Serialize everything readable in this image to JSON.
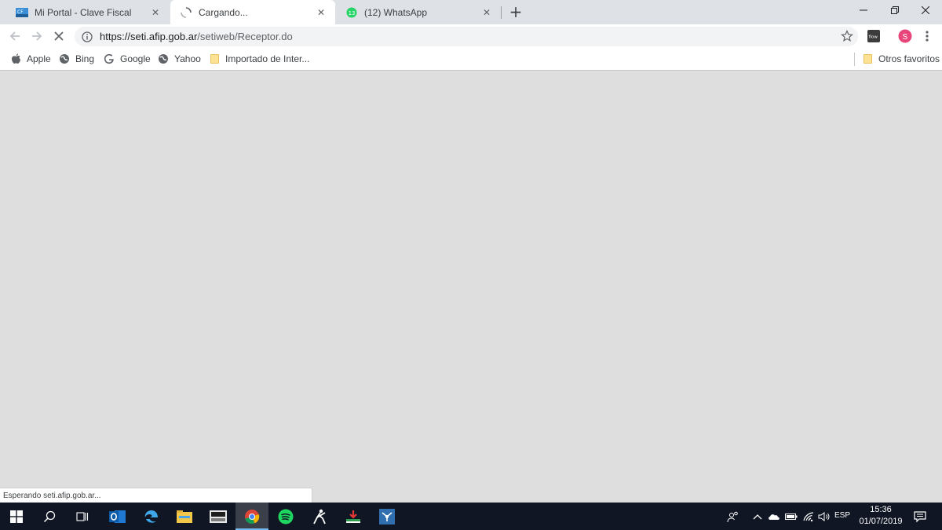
{
  "tabs": [
    {
      "title": "Mi Portal - Clave Fiscal",
      "icon": "afip-cf-icon",
      "active": false
    },
    {
      "title": "Cargando...",
      "icon": "loading-spinner-icon",
      "active": true
    },
    {
      "title": "(12) WhatsApp",
      "icon": "whatsapp-icon",
      "badge": "13",
      "active": false
    }
  ],
  "toolbar": {
    "url_host": "https://seti.afip.gob.ar",
    "url_path": "/setiweb/Receptor.do",
    "profile_initial": "S",
    "extension_label": "flow"
  },
  "bookmarks": [
    {
      "label": "Apple",
      "icon": "apple-icon"
    },
    {
      "label": "Bing",
      "icon": "globe-icon"
    },
    {
      "label": "Google",
      "icon": "google-icon"
    },
    {
      "label": "Yahoo",
      "icon": "globe-icon"
    },
    {
      "label": "Importado de Inter...",
      "icon": "folder-icon"
    }
  ],
  "other_bookmarks": "Otros favoritos",
  "status_text": "Esperando seti.afip.gob.ar...",
  "taskbar": {
    "apps": [
      "outlook-icon",
      "edge-icon",
      "file-explorer-icon",
      "afip-app-icon",
      "chrome-icon",
      "spotify-icon",
      "ninja-app-icon",
      "download-app-icon",
      "network-app-icon"
    ],
    "language": "ESP",
    "time": "15:36",
    "date": "01/07/2019"
  },
  "colors": {
    "content_bg": "#dedede",
    "tabstrip_bg": "#dee1e6",
    "taskbar_bg": "#101623",
    "profile_accent": "#e8457a",
    "whatsapp_green": "#25d366"
  }
}
